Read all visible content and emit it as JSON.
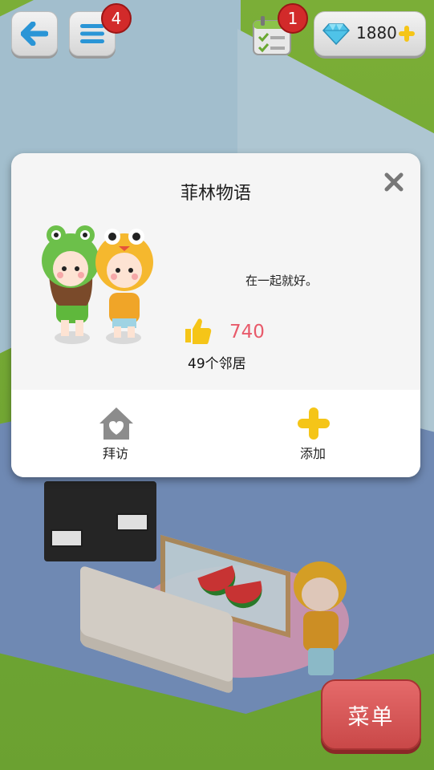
{
  "topbar": {
    "back_icon": "arrow-left-icon",
    "list_icon": "list-icon",
    "list_badge": "4",
    "task_icon": "calendar-checklist-icon",
    "task_badge": "1",
    "gem_icon": "diamond-icon",
    "gem_count": "1880",
    "gem_add_icon": "plus-icon"
  },
  "dialog": {
    "title": "菲林物语",
    "motto": "在一起就好。",
    "like_icon": "thumbs-up-icon",
    "likes": "740",
    "neighbors": "49个邻居",
    "actions": [
      {
        "label": "拜访",
        "icon": "house-heart-icon"
      },
      {
        "label": "添加",
        "icon": "plus-icon"
      }
    ]
  },
  "menu": {
    "label": "菜单"
  },
  "colors": {
    "likes": "#e85a6a",
    "badge": "#d22a2a",
    "menu_button": "#d85a5a",
    "accent_yellow": "#f5c518"
  }
}
